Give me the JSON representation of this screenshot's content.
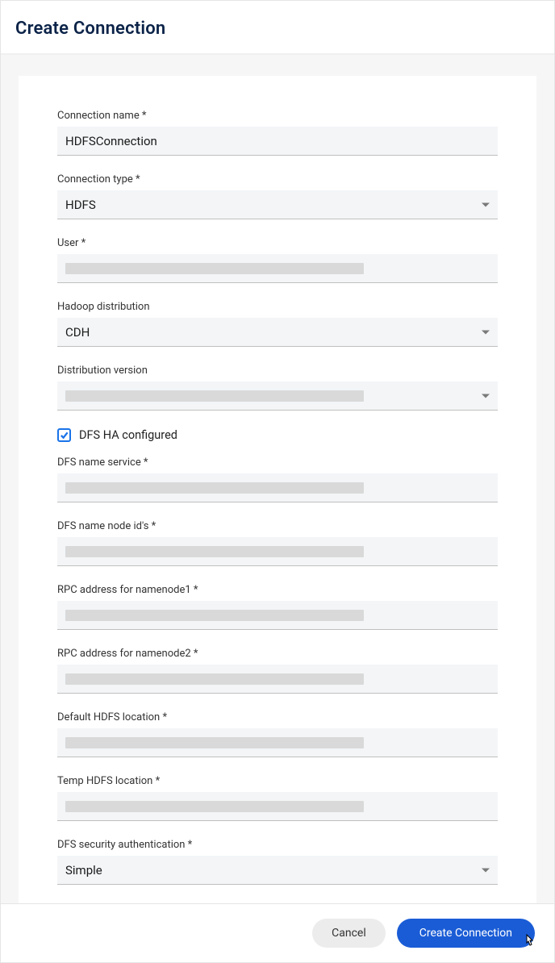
{
  "header": {
    "title": "Create Connection"
  },
  "fields": {
    "connection_name": {
      "label": "Connection name *",
      "value": "HDFSConnection"
    },
    "connection_type": {
      "label": "Connection type *",
      "value": "HDFS"
    },
    "user": {
      "label": "User *"
    },
    "hadoop_distribution": {
      "label": "Hadoop distribution",
      "value": "CDH"
    },
    "distribution_version": {
      "label": "Distribution version"
    },
    "dfs_ha": {
      "label": "DFS HA configured",
      "checked": true
    },
    "dfs_name_service": {
      "label": "DFS name service *"
    },
    "dfs_name_node_ids": {
      "label": "DFS name node id's *"
    },
    "rpc_namenode1": {
      "label": "RPC address for namenode1 *"
    },
    "rpc_namenode2": {
      "label": "RPC address for namenode2 *"
    },
    "default_hdfs_location": {
      "label": "Default HDFS location *"
    },
    "temp_hdfs_location": {
      "label": "Temp HDFS location *"
    },
    "dfs_security_auth": {
      "label": "DFS security authentication *",
      "value": "Simple"
    }
  },
  "footer": {
    "cancel": "Cancel",
    "create": "Create Connection"
  }
}
